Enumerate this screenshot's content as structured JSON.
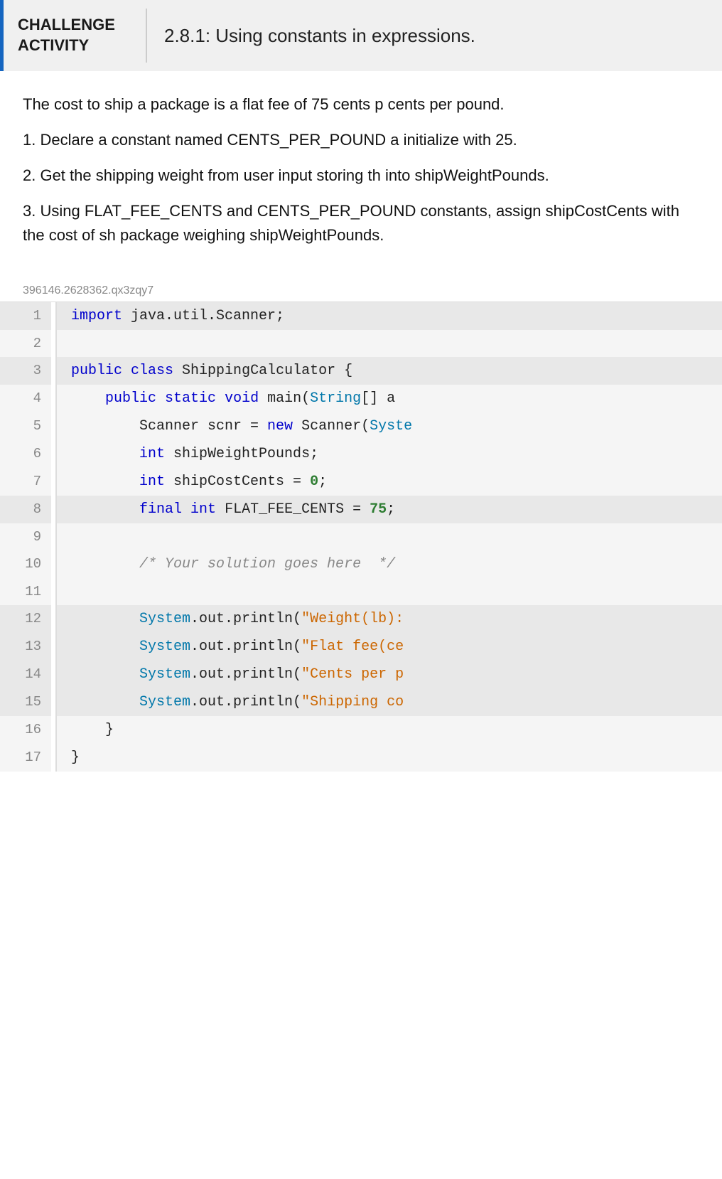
{
  "header": {
    "challenge_line1": "CHALLENGE",
    "challenge_line2": "ACTIVITY",
    "title": "2.8.1: Using constants in expressions."
  },
  "description": {
    "para1": "The cost to ship a package is a flat fee of 75 cents p cents per pound.",
    "para2": "1. Declare a constant named CENTS_PER_POUND a initialize with 25.",
    "para3": "2. Get the shipping weight from user input storing th into shipWeightPounds.",
    "para4": "3. Using FLAT_FEE_CENTS and CENTS_PER_POUND constants, assign shipCostCents with the cost of sh package weighing shipWeightPounds."
  },
  "problem_id": "396146.2628362.qx3zqy7",
  "code": {
    "lines": [
      {
        "num": 1,
        "highlighted": true,
        "content": "import java.util.Scanner;"
      },
      {
        "num": 2,
        "highlighted": false,
        "content": ""
      },
      {
        "num": 3,
        "highlighted": true,
        "content": "public class ShippingCalculator {"
      },
      {
        "num": 4,
        "highlighted": false,
        "content": "   public static void main(String[] a"
      },
      {
        "num": 5,
        "highlighted": false,
        "content": "      Scanner scnr = new Scanner(Syste"
      },
      {
        "num": 6,
        "highlighted": false,
        "content": "      int shipWeightPounds;"
      },
      {
        "num": 7,
        "highlighted": false,
        "content": "      int shipCostCents = 0;"
      },
      {
        "num": 8,
        "highlighted": true,
        "content": "      final int FLAT_FEE_CENTS = 75;"
      },
      {
        "num": 9,
        "highlighted": false,
        "content": ""
      },
      {
        "num": 10,
        "highlighted": false,
        "content": "      /* Your solution goes here  */"
      },
      {
        "num": 11,
        "highlighted": false,
        "content": ""
      },
      {
        "num": 12,
        "highlighted": true,
        "content": "      System.out.println(\"Weight(lb):"
      },
      {
        "num": 13,
        "highlighted": true,
        "content": "      System.out.println(\"Flat fee(ce"
      },
      {
        "num": 14,
        "highlighted": true,
        "content": "      System.out.println(\"Cents per p"
      },
      {
        "num": 15,
        "highlighted": true,
        "content": "      System.out.println(\"Shipping co"
      },
      {
        "num": 16,
        "highlighted": false,
        "content": "   }"
      },
      {
        "num": 17,
        "highlighted": false,
        "content": "}"
      }
    ]
  }
}
